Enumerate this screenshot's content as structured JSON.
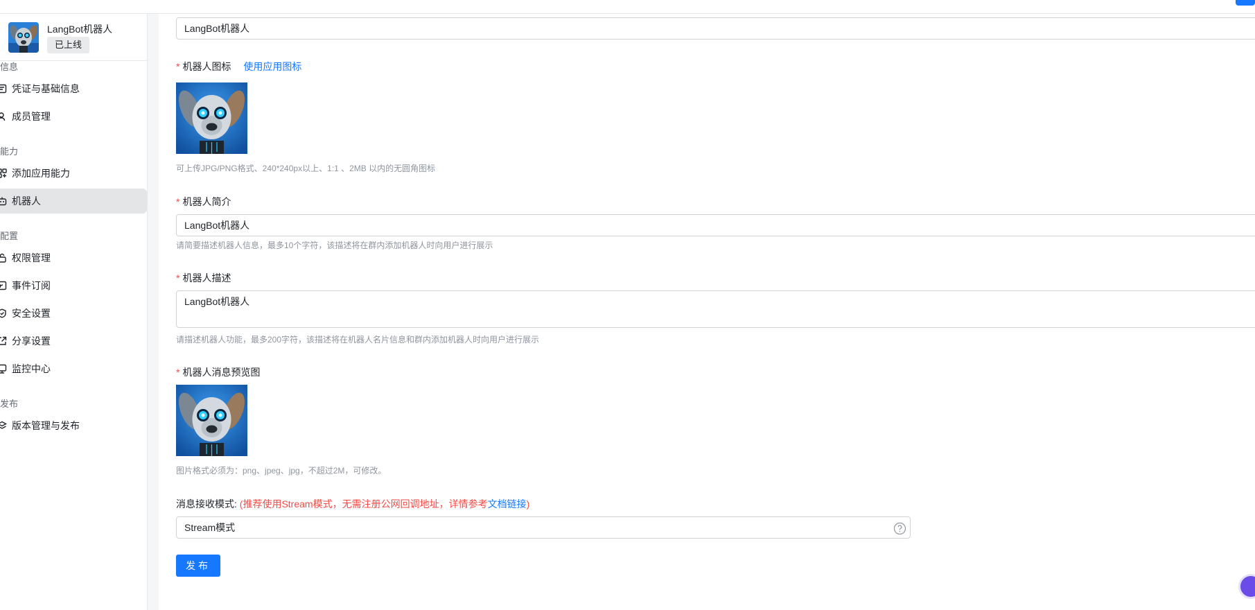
{
  "app": {
    "name": "LangBot机器人",
    "status": "已上线"
  },
  "sidebar": {
    "sections": [
      {
        "label": "信息"
      },
      {
        "label": "能力"
      },
      {
        "label": "配置"
      },
      {
        "label": "发布"
      }
    ],
    "items": [
      {
        "label": "凭证与基础信息",
        "icon": "credential-icon"
      },
      {
        "label": "成员管理",
        "icon": "members-icon"
      },
      {
        "label": "添加应用能力",
        "icon": "apps-grid-icon"
      },
      {
        "label": "机器人",
        "icon": "robot-icon",
        "active": true
      },
      {
        "label": "权限管理",
        "icon": "lock-icon"
      },
      {
        "label": "事件订阅",
        "icon": "subscribe-icon"
      },
      {
        "label": "安全设置",
        "icon": "shield-icon"
      },
      {
        "label": "分享设置",
        "icon": "share-icon"
      },
      {
        "label": "监控中心",
        "icon": "monitor-icon"
      },
      {
        "label": "版本管理与发布",
        "icon": "layers-icon"
      }
    ]
  },
  "form": {
    "bot_name_value": "LangBot机器人",
    "icon": {
      "label": "机器人图标",
      "link": "使用应用图标",
      "hint": "可上传JPG/PNG格式、240*240px以上、1:1 、2MB 以内的无圆角图标"
    },
    "intro": {
      "label": "机器人简介",
      "value": "LangBot机器人",
      "hint": "请简要描述机器人信息，最多10个字符，该描述将在群内添加机器人时向用户进行展示"
    },
    "description": {
      "label": "机器人描述",
      "value": "LangBot机器人",
      "hint": "请描述机器人功能，最多200字符，该描述将在机器人名片信息和群内添加机器人时向用户进行展示"
    },
    "preview": {
      "label": "机器人消息预览图",
      "hint": "图片格式必须为：png、jpeg、jpg，不超过2M，可修改。"
    },
    "mode": {
      "label": "消息接收模式:",
      "hint_prefix": "(推荐使用Stream模式，无需注册公网回调地址，详情参考",
      "hint_link": "文档链接",
      "hint_suffix": ")",
      "value": "Stream模式"
    },
    "publish_label": "发布"
  },
  "colors": {
    "accent": "#1677ff",
    "required": "#f54a45",
    "active_bg": "#e4e5e7"
  }
}
